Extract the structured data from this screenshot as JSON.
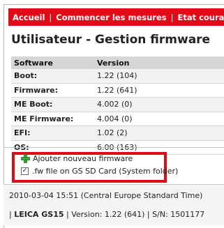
{
  "nav": {
    "items": [
      "Accueil",
      "Commencer les mesures",
      "Etat courant"
    ],
    "separator": "|"
  },
  "page_title": "Utilisateur - Gestion firmware",
  "table": {
    "headers": [
      "Software",
      "Version"
    ],
    "rows": [
      {
        "name": "Boot:",
        "version": "1.22 (104)"
      },
      {
        "name": "Firmware:",
        "version": "1.22 (641)"
      },
      {
        "name": "ME Boot:",
        "version": "4.002 (0)"
      },
      {
        "name": "ME Firmware:",
        "version": "4.004 (0)"
      },
      {
        "name": "EFI:",
        "version": "1.02 (2)"
      },
      {
        "name": "OS:",
        "version": "6.00 (163)"
      }
    ]
  },
  "actions": {
    "add_firmware": "Ajouter nouveau firmware",
    "fw_checkbox_label": ".fw file on GS SD Card (System folder)",
    "fw_checkbox_checked": true
  },
  "footer": {
    "timestamp": "2010-03-04 15:51 (Central Europe Standard Time)",
    "prefix": "|",
    "device": "LEICA GS15",
    "version_text": "| Version: 1.22 (641) | S/N: 1501177"
  },
  "colors": {
    "accent_red": "#e30a17",
    "plus_green": "#3aa63a"
  },
  "icons": {
    "add": "plus-icon",
    "checkbox": "checkbox-icon"
  }
}
